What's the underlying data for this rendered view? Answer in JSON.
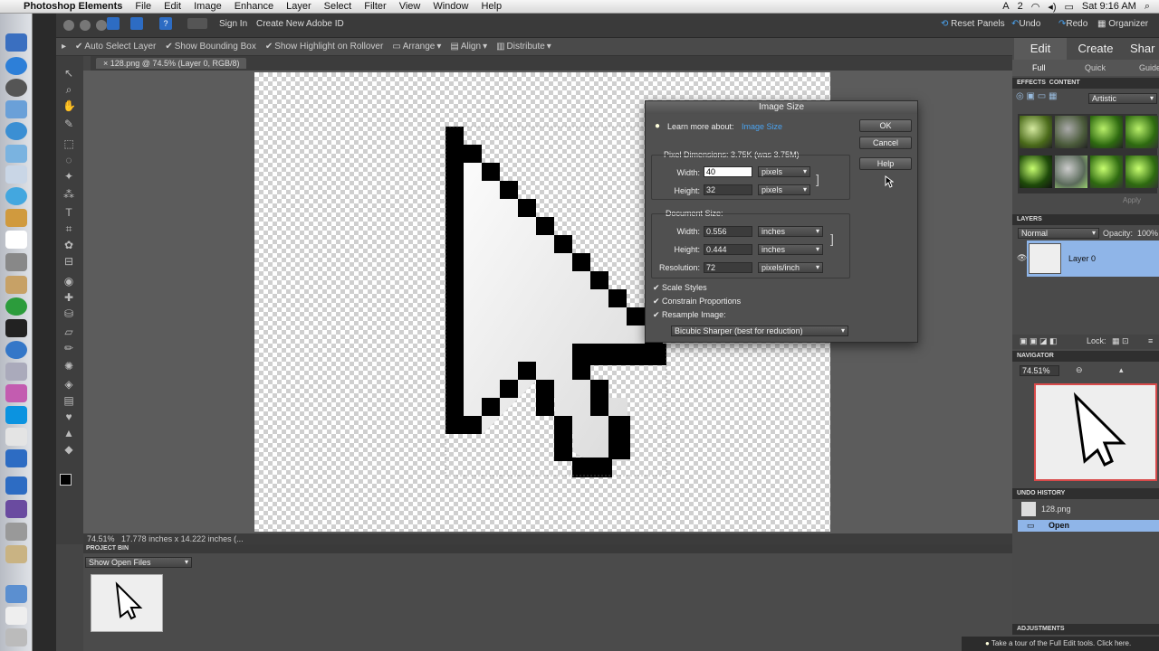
{
  "menubar": {
    "app": "Photoshop Elements",
    "items": [
      "File",
      "Edit",
      "Image",
      "Enhance",
      "Layer",
      "Select",
      "Filter",
      "View",
      "Window",
      "Help"
    ],
    "status_badge": "2",
    "clock": "Sat 9:16 AM"
  },
  "apptop": {
    "sign_in": "Sign In",
    "create_id": "Create New Adobe ID",
    "reset": "Reset Panels",
    "undo": "Undo",
    "redo": "Redo",
    "organizer": "Organizer"
  },
  "options": {
    "auto_select": "Auto Select Layer",
    "bounding": "Show Bounding Box",
    "highlight": "Show Highlight on Rollover",
    "arrange": "Arrange",
    "align": "Align",
    "distribute": "Distribute"
  },
  "doc": {
    "tab": "128.png @ 74.5% (Layer 0, RGB/8)",
    "zoom": "74.51%",
    "dimensions": "17.778 inches x 14.222 inches (..."
  },
  "project_bin": {
    "title": "PROJECT BIN",
    "dropdown": "Show Open Files"
  },
  "dialog": {
    "title": "Image Size",
    "learn": "Learn more about:",
    "learn_link": "Image Size",
    "ok": "OK",
    "cancel": "Cancel",
    "help": "Help",
    "pixel_dims": "Pixel Dimensions:  3.75K (was 3.75M)",
    "px_width_label": "Width:",
    "px_width": "40",
    "px_width_unit": "pixels",
    "px_height_label": "Height:",
    "px_height": "32",
    "px_height_unit": "pixels",
    "doc_size": "Document Size:",
    "doc_width_label": "Width:",
    "doc_width": "0.556",
    "doc_width_unit": "inches",
    "doc_height_label": "Height:",
    "doc_height": "0.444",
    "doc_height_unit": "inches",
    "res_label": "Resolution:",
    "resolution": "72",
    "res_unit": "pixels/inch",
    "scale_styles": "Scale Styles",
    "constrain": "Constrain Proportions",
    "resample": "Resample Image:",
    "resample_method": "Bicubic Sharper (best for reduction)"
  },
  "right": {
    "tabs": [
      "Edit",
      "Create",
      "Shar"
    ],
    "subtabs": [
      "Full",
      "Quick",
      "Guide"
    ],
    "effects": "EFFECTS",
    "content": "CONTENT",
    "effects_filter": "Artistic",
    "apply": "Apply",
    "layers": "LAYERS",
    "blend": "Normal",
    "opacity_label": "Opacity:",
    "opacity": "100%",
    "layer_name": "Layer 0",
    "lock": "Lock:",
    "navigator": "NAVIGATOR",
    "nav_zoom": "74.51%",
    "undo_history": "UNDO HISTORY",
    "history": [
      "128.png",
      "Open"
    ],
    "adjustments": "ADJUSTMENTS",
    "tip": "Take a tour of the Full Edit tools. Click here."
  }
}
